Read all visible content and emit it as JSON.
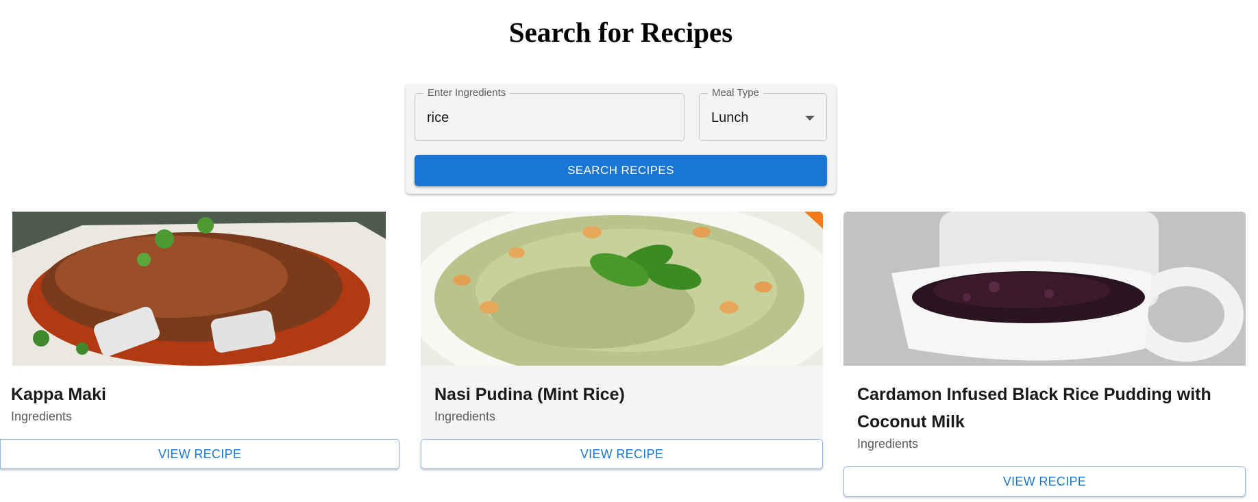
{
  "page": {
    "title": "Search for Recipes"
  },
  "search": {
    "ingredients_label": "Enter Ingredients",
    "ingredients_value": "rice",
    "meal_type_label": "Meal Type",
    "meal_type_value": "Lunch",
    "button_label": "SEARCH RECIPES"
  },
  "recipes": [
    {
      "title": "Kappa Maki",
      "subtitle": "Ingredients",
      "button_label": "VIEW RECIPE",
      "image_icon": "food-photo"
    },
    {
      "title": "Nasi Pudina (Mint Rice)",
      "subtitle": "Ingredients",
      "button_label": "VIEW RECIPE",
      "image_icon": "food-photo"
    },
    {
      "title": "Cardamon Infused Black Rice Pudding with Coconut Milk",
      "subtitle": "Ingredients",
      "button_label": "VIEW RECIPE",
      "image_icon": "food-photo"
    }
  ],
  "colors": {
    "accent": "#1976d2",
    "panel": "#f4f4f4"
  }
}
